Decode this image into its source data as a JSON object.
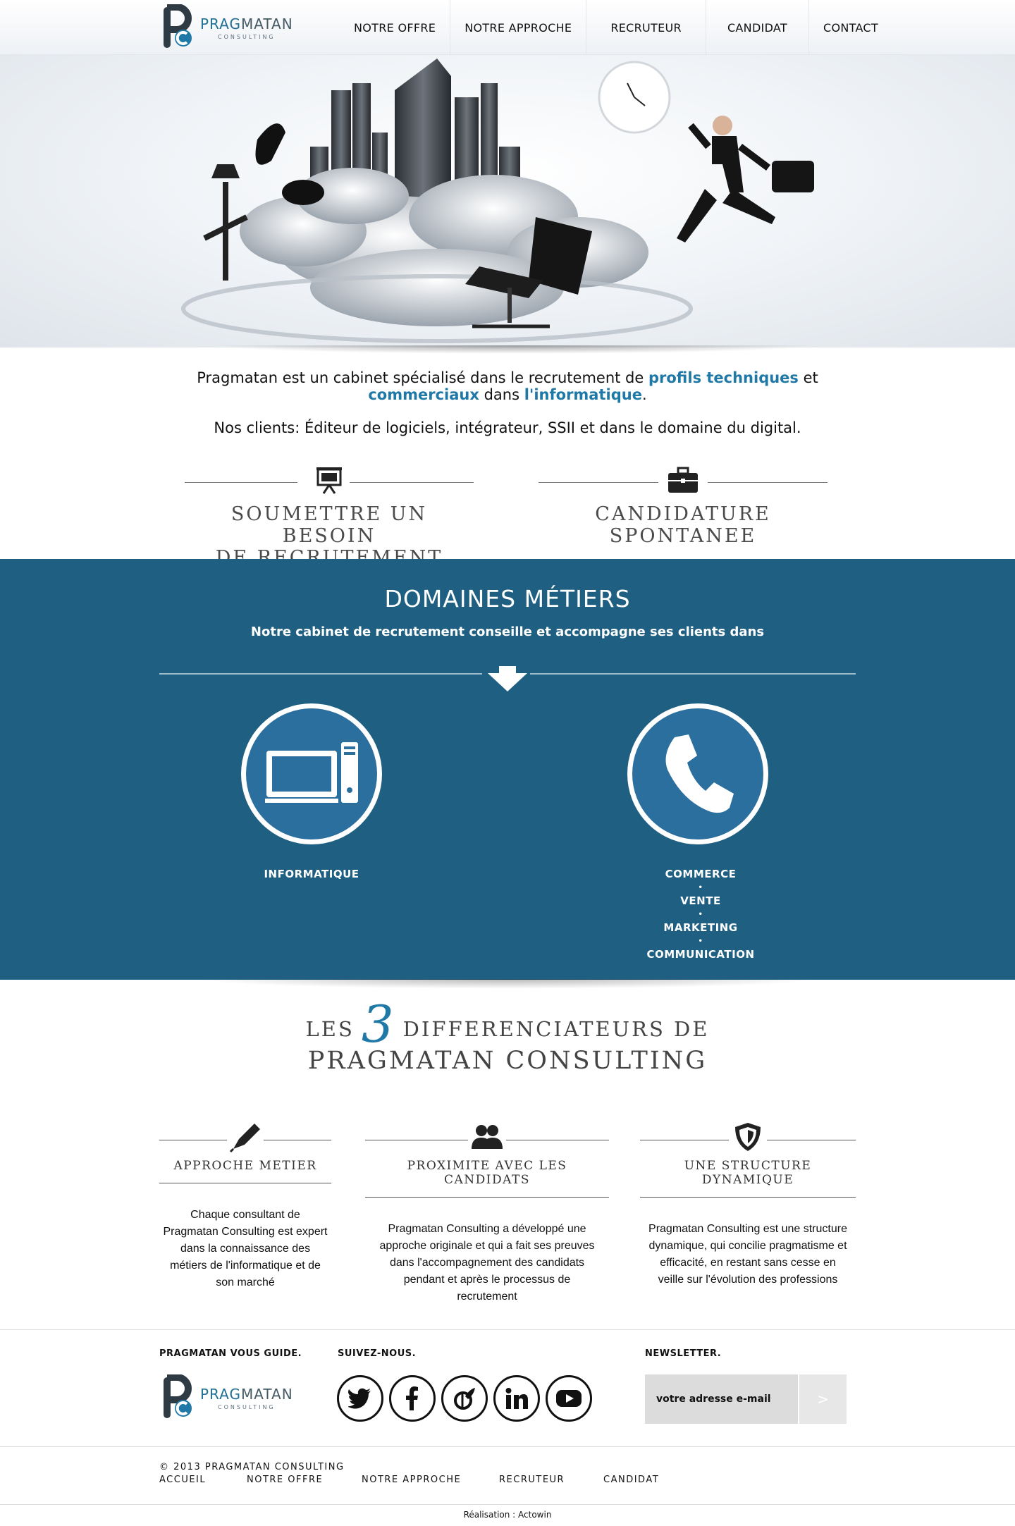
{
  "brand": {
    "name_part1": "PRAG",
    "name_part2": "MATAN",
    "tagline": "CONSULTING"
  },
  "nav": {
    "items": [
      "NOTRE OFFRE",
      "NOTRE APPROCHE",
      "RECRUTEUR",
      "CANDIDAT",
      "CONTACT"
    ]
  },
  "intro": {
    "line1_a": "Pragmatan est un cabinet spécialisé dans le recrutement de ",
    "line1_hl": "profils techniques",
    "line1_b": " et",
    "line2_hl1": "commerciaux",
    "line2_a": " dans ",
    "line2_hl2": "l'informatique",
    "line2_b": ".",
    "clients": "Nos clients: Éditeur de logiciels, intégrateur, SSII et dans le domaine du digital."
  },
  "cta": {
    "left_line1": "SOUMETTRE UN BESOIN",
    "left_line2": "DE RECRUTEMENT",
    "right_line1": "CANDIDATURE",
    "right_line2": "SPONTANEE"
  },
  "domaines": {
    "title": "DOMAINES MÉTIERS",
    "subtitle": "Notre cabinet de recrutement conseille et accompagne ses clients dans",
    "left_label": "INFORMATIQUE",
    "right_items": [
      "COMMERCE",
      "VENTE",
      "MARKETING",
      "COMMUNICATION"
    ],
    "separator": "•"
  },
  "diff": {
    "row1_a": "LES",
    "row1_num": "3",
    "row1_b": "DIFFERENCIATEURS DE",
    "row2": "PRAGMATAN CONSULTING",
    "features": [
      {
        "title": "APPROCHE METIER",
        "icon": "pen-icon",
        "text_lines": [
          "Chaque consultant de",
          "Pragmatan Consulting est expert",
          "dans la connaissance des",
          "métiers de l'informatique et de",
          "son marché"
        ]
      },
      {
        "title": "PROXIMITE AVEC LES CANDIDATS",
        "icon": "people-icon",
        "text_lines": [
          "Pragmatan Consulting a développé une",
          "approche originale et qui a fait ses preuves",
          "dans l'accompagnement des candidats",
          "pendant et après le processus de",
          "recrutement"
        ]
      },
      {
        "title": "UNE STRUCTURE DYNAMIQUE",
        "icon": "shield-icon",
        "text_lines": [
          "Pragmatan Consulting est une structure",
          "dynamique, qui concilie pragmatisme et",
          "efficacité, en restant sans cesse en",
          "veille sur l'évolution des professions"
        ]
      }
    ]
  },
  "footer": {
    "guide_heading": "PRAGMATAN VOUS GUIDE.",
    "follow_heading": "SUIVEZ-NOUS.",
    "newsletter_heading": "NEWSLETTER.",
    "newsletter_placeholder": "votre adresse e-mail",
    "newsletter_submit": ">",
    "social": [
      "twitter-icon",
      "facebook-icon",
      "viadeo-icon",
      "linkedin-icon",
      "youtube-icon"
    ],
    "copyright": "© 2013 PRAGMATAN CONSULTING",
    "links": [
      "ACCUEIL",
      "NOTRE OFFRE",
      "NOTRE APPROCHE",
      "RECRUTEUR",
      "CANDIDAT"
    ],
    "credit": "Réalisation : Actowin"
  },
  "colors": {
    "accent": "#1f78a6",
    "band": "#1e5f82",
    "circle_fill": "#2a6f9e"
  }
}
